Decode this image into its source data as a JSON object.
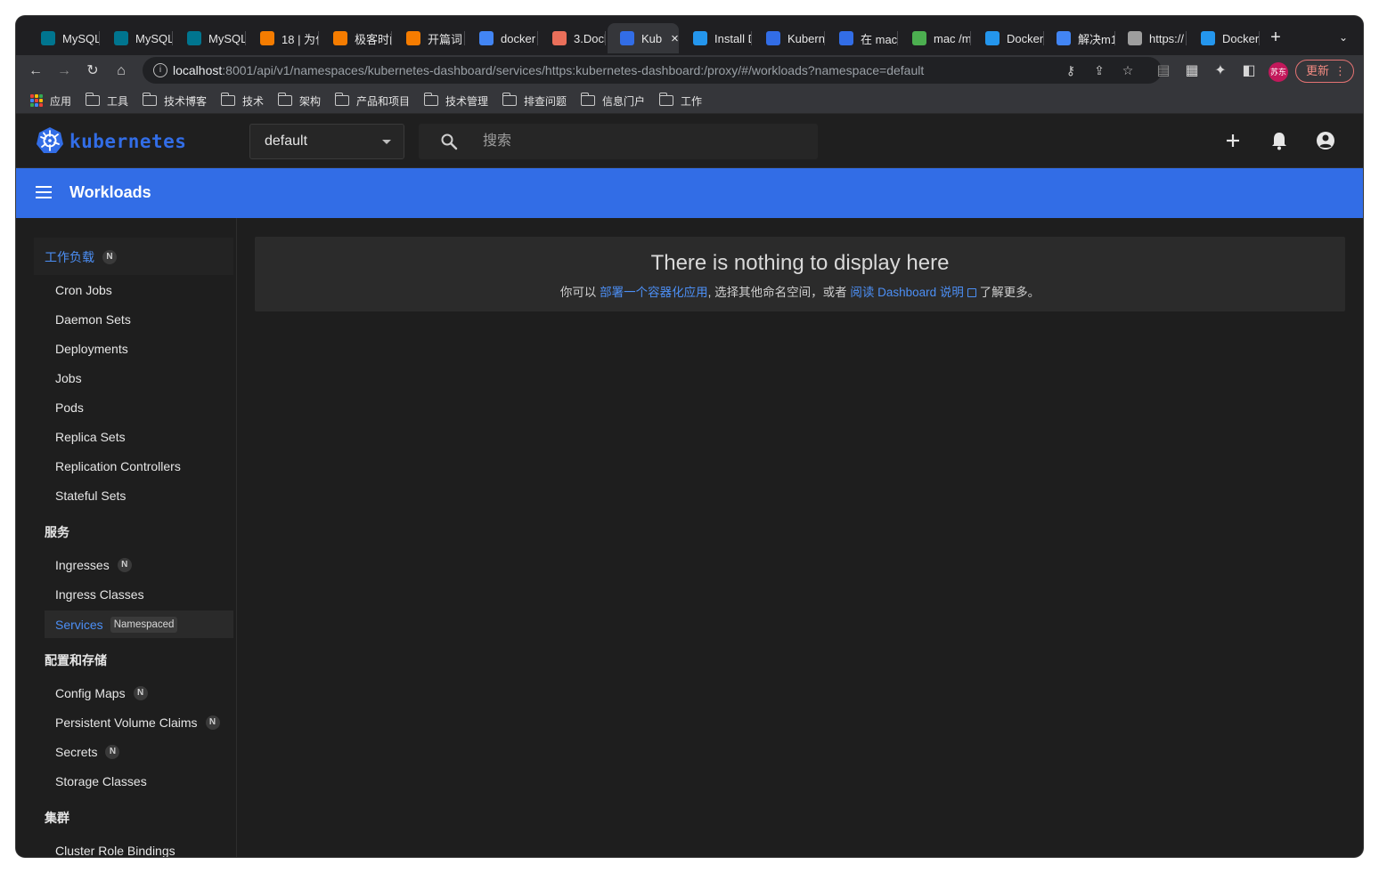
{
  "browser": {
    "tabs": [
      {
        "label": "MySQL",
        "icon": "mysql-icon",
        "color": "#00758f"
      },
      {
        "label": "MySQL",
        "icon": "mysql-icon",
        "color": "#00758f"
      },
      {
        "label": "MySQL",
        "icon": "mysql-icon",
        "color": "#00758f"
      },
      {
        "label": "18 | 为什",
        "icon": "geekbang-icon",
        "color": "#f57c00"
      },
      {
        "label": "极客时间",
        "icon": "geekbang-icon",
        "color": "#f57c00"
      },
      {
        "label": "开篇词",
        "icon": "geekbang-icon",
        "color": "#f57c00"
      },
      {
        "label": "docker",
        "icon": "google-icon",
        "color": "#4285f4"
      },
      {
        "label": "3.Dock",
        "icon": "jianshu-icon",
        "color": "#ea6f5a"
      },
      {
        "label": "Kub",
        "icon": "kubernetes-icon",
        "color": "#326de6"
      },
      {
        "label": "Install D",
        "icon": "docker-icon",
        "color": "#2496ed"
      },
      {
        "label": "Kubern",
        "icon": "kubernetes-icon",
        "color": "#326de6"
      },
      {
        "label": "在 mac",
        "icon": "kubernetes-icon",
        "color": "#326de6"
      },
      {
        "label": "mac /m",
        "icon": "image-icon",
        "color": "#4caf50"
      },
      {
        "label": "Docker",
        "icon": "docker-icon",
        "color": "#2496ed"
      },
      {
        "label": "解决m1",
        "icon": "google-icon",
        "color": "#4285f4"
      },
      {
        "label": "https://",
        "icon": "globe-icon",
        "color": "#9e9e9e"
      },
      {
        "label": "Docker",
        "icon": "docker-icon",
        "color": "#2496ed"
      }
    ],
    "active_tab_index": 8,
    "url_host": "localhost",
    "url_rest": ":8001/api/v1/namespaces/kubernetes-dashboard/services/https:kubernetes-dashboard:/proxy/#/workloads?namespace=default",
    "profile_label": "苏东",
    "update_label": "更新",
    "bookmarks": [
      {
        "label": "应用",
        "icon": "apps-grid-icon"
      },
      {
        "label": "工具",
        "icon": "folder-icon"
      },
      {
        "label": "技术博客",
        "icon": "folder-icon"
      },
      {
        "label": "技术",
        "icon": "folder-icon"
      },
      {
        "label": "架构",
        "icon": "folder-icon"
      },
      {
        "label": "产品和项目",
        "icon": "folder-icon"
      },
      {
        "label": "技术管理",
        "icon": "folder-icon"
      },
      {
        "label": "排查问题",
        "icon": "folder-icon"
      },
      {
        "label": "信息门户",
        "icon": "folder-icon"
      },
      {
        "label": "工作",
        "icon": "folder-icon"
      }
    ]
  },
  "header": {
    "brand": "kubernetes",
    "namespace": "default",
    "search_placeholder": "搜索"
  },
  "titlebar": {
    "title": "Workloads"
  },
  "sidebar": {
    "workloads": {
      "label": "工作负载",
      "badge": "N"
    },
    "workload_items": [
      {
        "label": "Cron Jobs"
      },
      {
        "label": "Daemon Sets"
      },
      {
        "label": "Deployments"
      },
      {
        "label": "Jobs"
      },
      {
        "label": "Pods"
      },
      {
        "label": "Replica Sets"
      },
      {
        "label": "Replication Controllers"
      },
      {
        "label": "Stateful Sets"
      }
    ],
    "services": {
      "label": "服务"
    },
    "service_items": [
      {
        "label": "Ingresses",
        "badge": "N"
      },
      {
        "label": "Ingress Classes"
      },
      {
        "label": "Services",
        "tag": "Namespaced"
      }
    ],
    "config": {
      "label": "配置和存储"
    },
    "config_items": [
      {
        "label": "Config Maps",
        "badge": "N"
      },
      {
        "label": "Persistent Volume Claims",
        "badge": "N"
      },
      {
        "label": "Secrets",
        "badge": "N"
      },
      {
        "label": "Storage Classes"
      }
    ],
    "cluster": {
      "label": "集群"
    },
    "cluster_items": [
      {
        "label": "Cluster Role Bindings"
      }
    ]
  },
  "main": {
    "empty_title": "There is nothing to display here",
    "empty_prefix": "你可以 ",
    "empty_link1": "部署一个容器化应用",
    "empty_middle": ", 选择其他命名空间，或者 ",
    "empty_link2": "阅读 Dashboard 说明",
    "empty_suffix": " 了解更多。"
  },
  "colors": {
    "accent": "#326de6",
    "link": "#4c8ff5",
    "background": "#1e1e1e"
  }
}
